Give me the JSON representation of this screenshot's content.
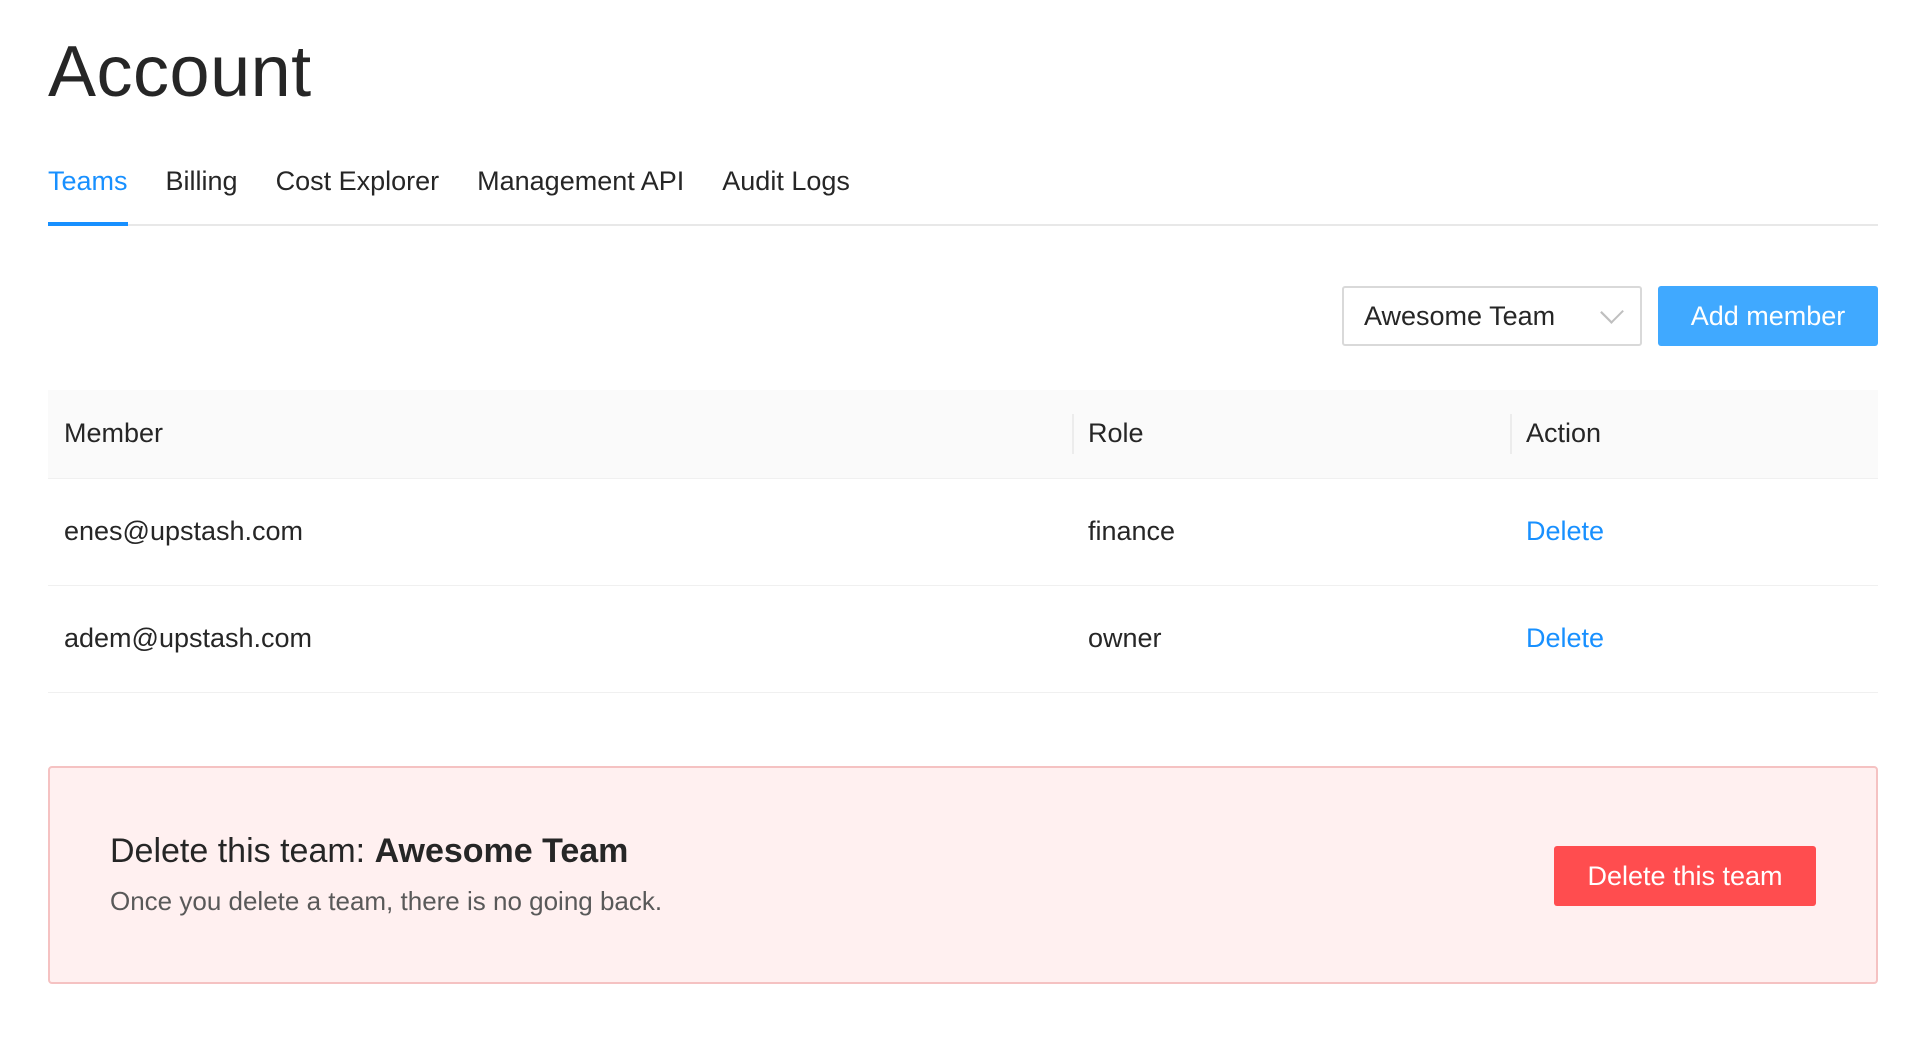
{
  "page": {
    "title": "Account"
  },
  "tabs": [
    {
      "label": "Teams",
      "active": true
    },
    {
      "label": "Billing"
    },
    {
      "label": "Cost Explorer"
    },
    {
      "label": "Management API"
    },
    {
      "label": "Audit Logs"
    }
  ],
  "toolbar": {
    "team_select_value": "Awesome Team",
    "add_member_label": "Add member"
  },
  "table": {
    "columns": [
      "Member",
      "Role",
      "Action"
    ],
    "rows": [
      {
        "member": "enes@upstash.com",
        "role": "finance",
        "action": "Delete"
      },
      {
        "member": "adem@upstash.com",
        "role": "owner",
        "action": "Delete"
      }
    ]
  },
  "danger_zone": {
    "title_prefix": "Delete this team: ",
    "team_name": "Awesome Team",
    "description": "Once you delete a team, there is no going back.",
    "button_label": "Delete this team"
  },
  "colors": {
    "accent": "#1890ff",
    "primary_button": "#40a9ff",
    "danger": "#ff4d4f",
    "danger_bg": "#fff0f0"
  },
  "icons": {
    "select_arrow": "chevron-down-icon"
  }
}
